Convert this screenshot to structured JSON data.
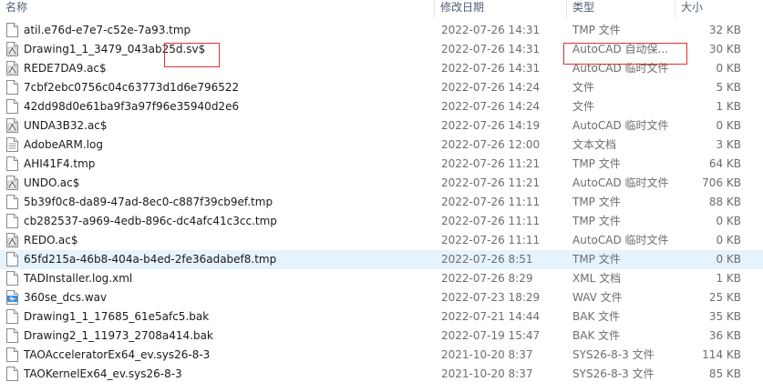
{
  "columns": {
    "name": "名称",
    "date": "修改日期",
    "type": "类型",
    "size": "大小"
  },
  "files": [
    {
      "name": "atil.e76d-e7e7-c52e-7a93.tmp",
      "date": "2022-07-26 14:31",
      "type": "TMP 文件",
      "size": "32 KB",
      "icon": "blank-file-icon"
    },
    {
      "name": "Drawing1_1_3479_043ab25d.sv$",
      "date": "2022-07-26 14:31",
      "type": "AutoCAD 自动保...",
      "size": "30 KB",
      "icon": "autocad-file-icon"
    },
    {
      "name": "REDE7DA9.ac$",
      "date": "2022-07-26 14:31",
      "type": "AutoCAD 临时文件",
      "size": "0 KB",
      "icon": "autocad-file-icon"
    },
    {
      "name": "7cbf2ebc0756c04c63773d1d6e796522",
      "date": "2022-07-26 14:24",
      "type": "文件",
      "size": "5 KB",
      "icon": "blank-file-icon"
    },
    {
      "name": "42dd98d0e61ba9f3a97f96e35940d2e6",
      "date": "2022-07-26 14:24",
      "type": "文件",
      "size": "1 KB",
      "icon": "blank-file-icon"
    },
    {
      "name": "UNDA3B32.ac$",
      "date": "2022-07-26 14:19",
      "type": "AutoCAD 临时文件",
      "size": "0 KB",
      "icon": "autocad-file-icon"
    },
    {
      "name": "AdobeARM.log",
      "date": "2022-07-26 12:00",
      "type": "文本文档",
      "size": "3 KB",
      "icon": "text-file-icon"
    },
    {
      "name": "AHI41F4.tmp",
      "date": "2022-07-26 11:21",
      "type": "TMP 文件",
      "size": "64 KB",
      "icon": "blank-file-icon"
    },
    {
      "name": "UNDO.ac$",
      "date": "2022-07-26 11:21",
      "type": "AutoCAD 临时文件",
      "size": "706 KB",
      "icon": "autocad-file-icon"
    },
    {
      "name": "5b39f0c8-da89-47ad-8ec0-c887f39cb9ef.tmp",
      "date": "2022-07-26 11:11",
      "type": "TMP 文件",
      "size": "88 KB",
      "icon": "blank-file-icon"
    },
    {
      "name": "cb282537-a969-4edb-896c-dc4afc41c3cc.tmp",
      "date": "2022-07-26 11:11",
      "type": "TMP 文件",
      "size": "0 KB",
      "icon": "blank-file-icon"
    },
    {
      "name": "REDO.ac$",
      "date": "2022-07-26 11:11",
      "type": "AutoCAD 临时文件",
      "size": "0 KB",
      "icon": "autocad-file-icon"
    },
    {
      "name": "65fd215a-46b8-404a-b4ed-2fe36adabef8.tmp",
      "date": "2022-07-26 8:51",
      "type": "TMP 文件",
      "size": "0 KB",
      "icon": "blank-file-icon",
      "selected": true
    },
    {
      "name": "TADInstaller.log.xml",
      "date": "2022-07-26 8:29",
      "type": "XML 文档",
      "size": "1 KB",
      "icon": "blank-file-icon"
    },
    {
      "name": "360se_dcs.wav",
      "date": "2022-07-23 18:29",
      "type": "WAV 文件",
      "size": "25 KB",
      "icon": "audio-file-icon"
    },
    {
      "name": "Drawing1_1_17685_61e5afc5.bak",
      "date": "2022-07-21 14:44",
      "type": "BAK 文件",
      "size": "35 KB",
      "icon": "blank-file-icon"
    },
    {
      "name": "Drawing2_1_11973_2708a414.bak",
      "date": "2022-07-19 15:47",
      "type": "BAK 文件",
      "size": "36 KB",
      "icon": "blank-file-icon"
    },
    {
      "name": "TAOAcceleratorEx64_ev.sys26-8-3",
      "date": "2021-10-20 8:37",
      "type": "SYS26-8-3 文件",
      "size": "114 KB",
      "icon": "blank-file-icon"
    },
    {
      "name": "TAOKernelEx64_ev.sys26-8-3",
      "date": "2021-10-20 8:37",
      "type": "SYS26-8-3 文件",
      "size": "85 KB",
      "icon": "blank-file-icon"
    }
  ]
}
